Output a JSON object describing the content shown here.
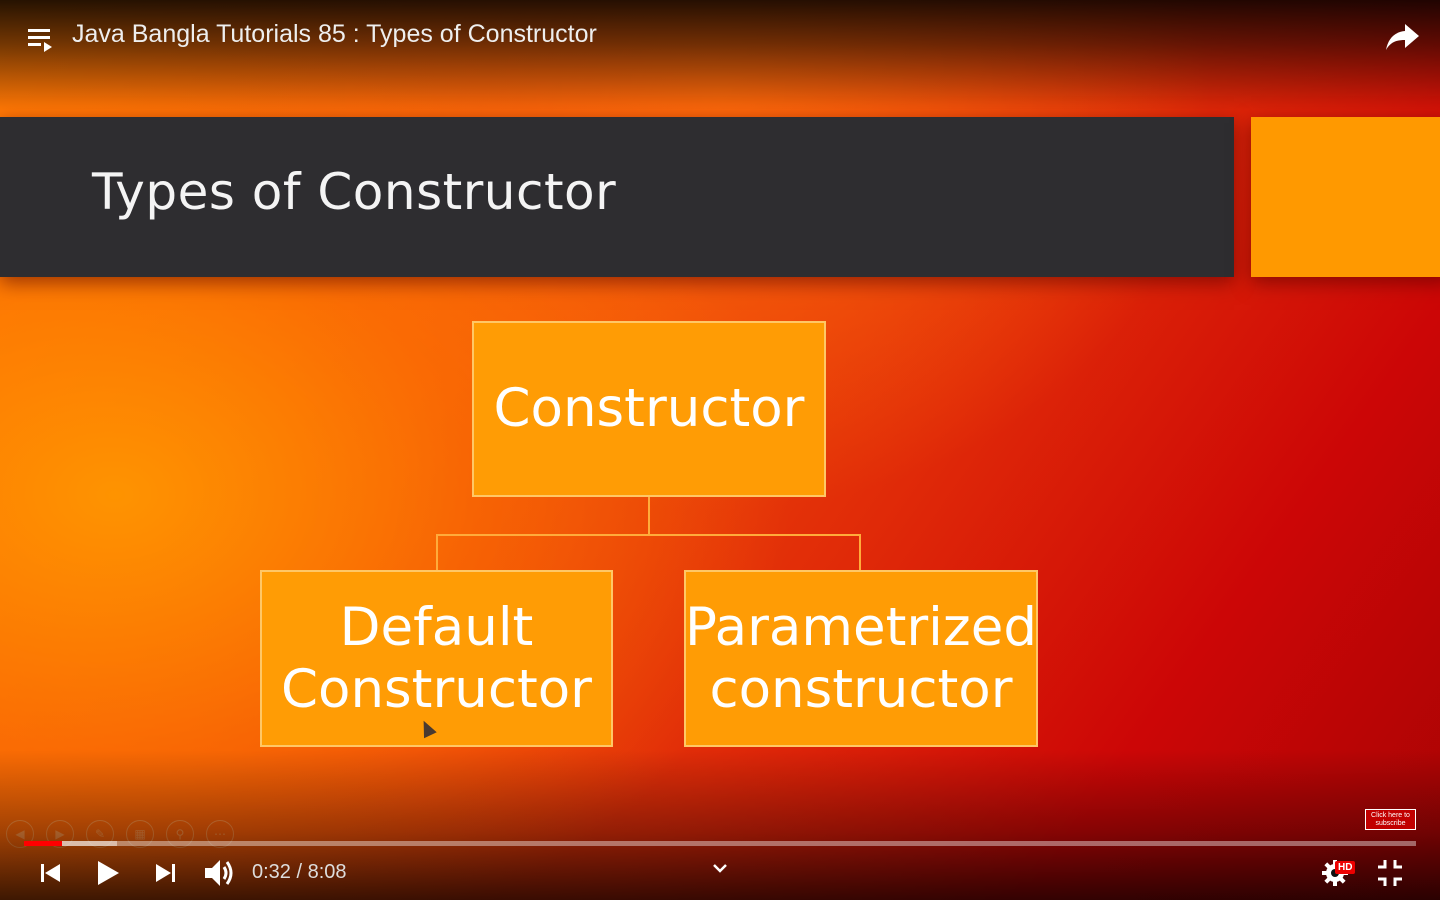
{
  "player": {
    "title": "Java Bangla Tutorials 85 : Types of Constructor",
    "time": "0:32 / 8:08",
    "progress_fraction": 0.027,
    "buffer_fraction": 0.067,
    "hd_badge": "HD",
    "subscribe_label": "Click here to subscribe",
    "accent_color": "#ff0000"
  },
  "slide": {
    "title": "Types of Constructor",
    "root_box": "Constructor",
    "child_boxes": [
      "Default\nConstructor",
      "Parametrized\nconstructor"
    ],
    "box_color": "#ff9c05",
    "banner_color": "#2e2d30"
  },
  "icons": {
    "playlist": "playlist-icon",
    "share": "share-icon",
    "prev": "skip-previous-icon",
    "play": "play-icon",
    "next": "skip-next-icon",
    "volume": "volume-icon",
    "settings": "gear-icon",
    "fullscreen": "exit-fullscreen-icon"
  }
}
